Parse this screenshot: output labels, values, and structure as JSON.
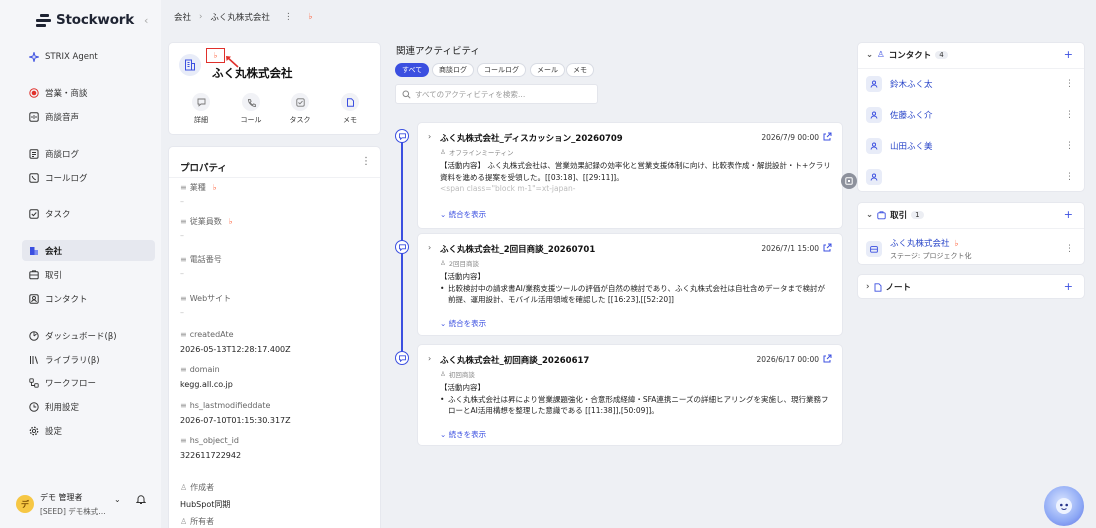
{
  "app": {
    "name": "Stockwork"
  },
  "colors": {
    "accent": "#3b4fe0",
    "hubspot": "#ff5c35",
    "highlight_box": "#e0302b"
  },
  "sidebar": {
    "items": [
      {
        "label": "STRIX Agent",
        "icon": "sparkle-icon"
      },
      {
        "label": "営業・商談",
        "icon": "record-icon"
      },
      {
        "label": "商談音声",
        "icon": "audio-icon"
      },
      {
        "label": "商談ログ",
        "icon": "log-icon"
      },
      {
        "label": "コールログ",
        "icon": "call-log-icon"
      },
      {
        "label": "タスク",
        "icon": "task-icon"
      },
      {
        "label": "会社",
        "icon": "building-icon"
      },
      {
        "label": "取引",
        "icon": "deal-icon"
      },
      {
        "label": "コンタクト",
        "icon": "contact-icon"
      },
      {
        "label": "ダッシュボード(β)",
        "icon": "dashboard-icon"
      },
      {
        "label": "ライブラリ(β)",
        "icon": "library-icon"
      },
      {
        "label": "ワークフロー",
        "icon": "workflow-icon"
      },
      {
        "label": "利用設定",
        "icon": "usage-icon"
      },
      {
        "label": "設定",
        "icon": "gear-icon"
      }
    ],
    "user": {
      "avatar": "デ",
      "name": "デモ 管理者",
      "org": "[SEED] デモ株式…"
    }
  },
  "breadcrumb": {
    "parent": "会社",
    "current": "ふく丸株式会社"
  },
  "company": {
    "name": "ふく丸株式会社",
    "actions": [
      {
        "label": "詳細",
        "icon": "chat-icon"
      },
      {
        "label": "コール",
        "icon": "phone-icon"
      },
      {
        "label": "タスク",
        "icon": "task-check-icon"
      },
      {
        "label": "メモ",
        "icon": "memo-icon"
      }
    ]
  },
  "properties": {
    "title": "プロパティ",
    "items": [
      {
        "label": "業種",
        "value": "–",
        "hubspot": true
      },
      {
        "label": "従業員数",
        "value": "–",
        "hubspot": true
      },
      {
        "label": "電話番号",
        "value": "–",
        "hubspot": false
      },
      {
        "label": "Webサイト",
        "value": "–",
        "hubspot": false
      },
      {
        "label": "createdAte",
        "value": "2026-05-13T12:28:17.400Z",
        "hubspot": false
      },
      {
        "label": "domain",
        "value": "kegg.all.co.jp",
        "hubspot": false
      },
      {
        "label": "hs_lastmodifieddate",
        "value": "2026-07-10T01:15:30.317Z",
        "hubspot": false
      },
      {
        "label": "hs_object_id",
        "value": "322611722942",
        "hubspot": false
      },
      {
        "label": "作成者",
        "value": "HubSpot同期",
        "hubspot": false
      },
      {
        "label": "所有者",
        "value": "",
        "hubspot": false
      }
    ]
  },
  "activity": {
    "title": "関連アクティビティ",
    "tabs": [
      "すべて",
      "商談ログ",
      "コールログ",
      "メール",
      "メモ"
    ],
    "search_placeholder": "すべてのアクティビティを検索…",
    "items": [
      {
        "title": "ふく丸株式会社_ディスカッション_20260709",
        "date": "2026/7/9 00:00",
        "sub": "オフラインミーティン",
        "body_head": "【活動内容】 ふく丸株式会社は、営業効果記録の効率化と営業支援体制に向け、比較表作成・解説設計・ト+クラリ資料を進める提案を受領した。[[03:18]、[[29:11]]。",
        "body_faded": "<span class=\"block m-1\"=xt-japan-",
        "more": "続合を表示"
      },
      {
        "title": "ふく丸株式会社_2回目商談_20260701",
        "date": "2026/7/1 15:00",
        "sub": "2回目商談",
        "body_head": "【活動内容】",
        "bullet": "比較検討中の請求書AI/業務支援ツールの評価が自然の検討であり、ふく丸株式会社は自社含めデータまで検討が前提、運用設計、モバイル活用領域を確認した [[16:23],[[52:20]]",
        "more": "続合を表示"
      },
      {
        "title": "ふく丸株式会社_初回商談_20260617",
        "date": "2026/6/17 00:00",
        "sub": "初回商談",
        "body_head": "【活動内容】",
        "bullet": "ふく丸株式会社は昇により営業課題強化・合意形成経緯・SFA連携ニーズの詳細ヒアリングを実施し、現行業務フローとAI活用構想を整理した意識である [[11:38]],[50:09]]。",
        "more": "続きを表示"
      }
    ]
  },
  "right": {
    "contacts": {
      "title": "コンタクト",
      "count": "4",
      "items": [
        "鈴木ふく太",
        "佐藤ふく介",
        "山田ふく美",
        ""
      ]
    },
    "deals": {
      "title": "取引",
      "count": "1",
      "items": [
        {
          "name": "ふく丸株式会社",
          "stage": "ステージ: プロジェクト化"
        }
      ]
    },
    "notes": {
      "title": "ノート"
    }
  }
}
